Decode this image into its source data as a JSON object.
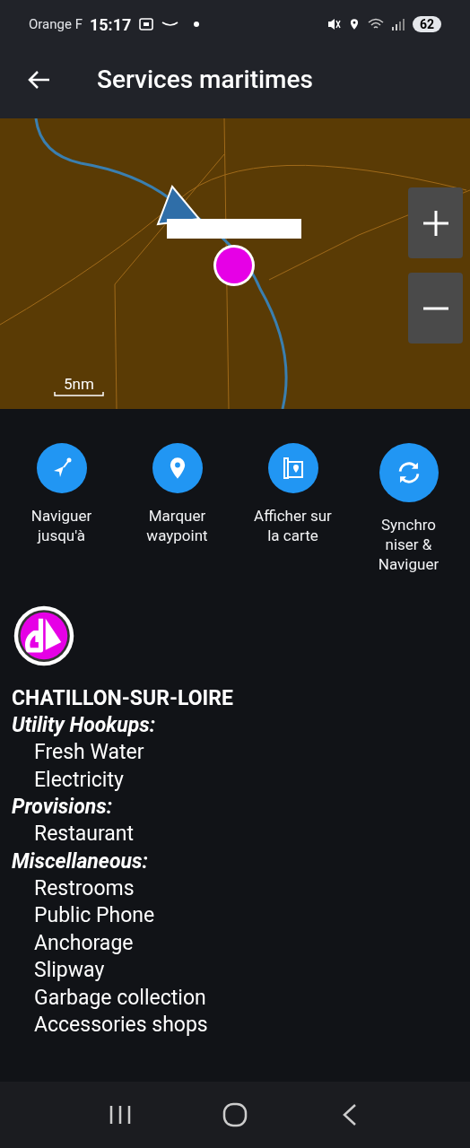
{
  "status_bar": {
    "carrier": "Orange F",
    "time": "15:17",
    "battery": "62"
  },
  "app_bar": {
    "title": "Services maritimes"
  },
  "map": {
    "scale": "5nm"
  },
  "actions": [
    {
      "label": "Naviguer\njusqu'à",
      "kind": "navigate"
    },
    {
      "label": "Marquer\nwaypoint",
      "kind": "pin"
    },
    {
      "label": "Afficher sur\nla carte",
      "kind": "map"
    },
    {
      "label": "Synchro\nniser &\nNaviguer",
      "kind": "sync"
    }
  ],
  "place": {
    "name": "CHATILLON-SUR-LOIRE",
    "sections": [
      {
        "title": "Utility Hookups:",
        "items": [
          "Fresh Water",
          "Electricity"
        ]
      },
      {
        "title": "Provisions:",
        "items": [
          "Restaurant"
        ]
      },
      {
        "title": "Miscellaneous:",
        "items": [
          "Restrooms",
          "Public Phone",
          "Anchorage",
          "Slipway",
          "Garbage collection",
          "Accessories shops"
        ]
      }
    ]
  }
}
